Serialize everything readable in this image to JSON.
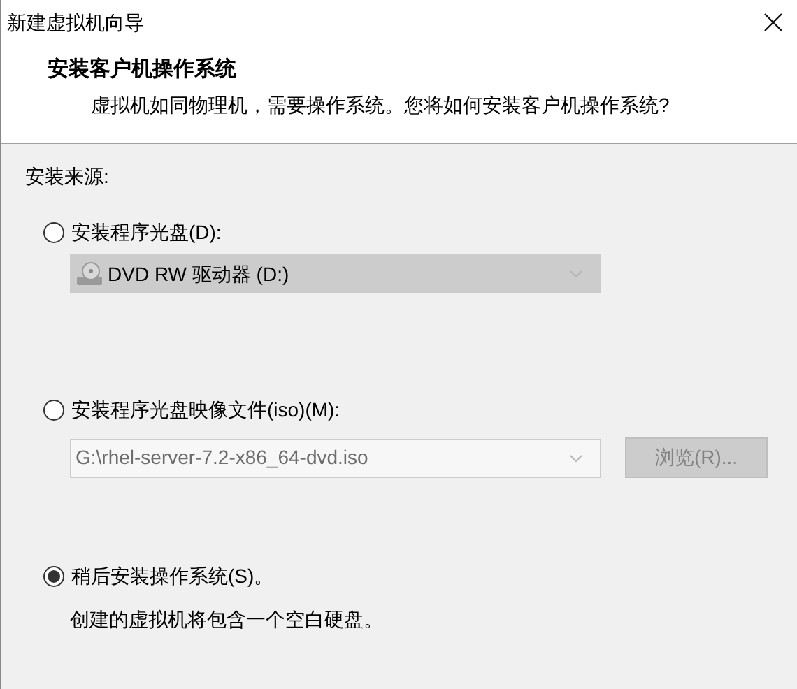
{
  "window": {
    "title": "新建虚拟机向导"
  },
  "header": {
    "title": "安装客户机操作系统",
    "subtitle": "虚拟机如同物理机，需要操作系统。您将如何安装客户机操作系统?"
  },
  "group": {
    "label": "安装来源:"
  },
  "options": [
    {
      "kind": "disc",
      "label": "安装程序光盘(D):",
      "selected": false,
      "combo": {
        "value": "DVD RW 驱动器 (D:)",
        "disabled": true
      }
    },
    {
      "kind": "iso",
      "label": "安装程序光盘映像文件(iso)(M):",
      "selected": false,
      "combo": {
        "value": "G:\\rhel-server-7.2-x86_64-dvd.iso",
        "disabled": true
      },
      "button": {
        "label": "浏览(R)...",
        "disabled": true
      }
    },
    {
      "kind": "later",
      "label": "稍后安装操作系统(S)。",
      "selected": true,
      "note": "创建的虚拟机将包含一个空白硬盘。"
    }
  ]
}
